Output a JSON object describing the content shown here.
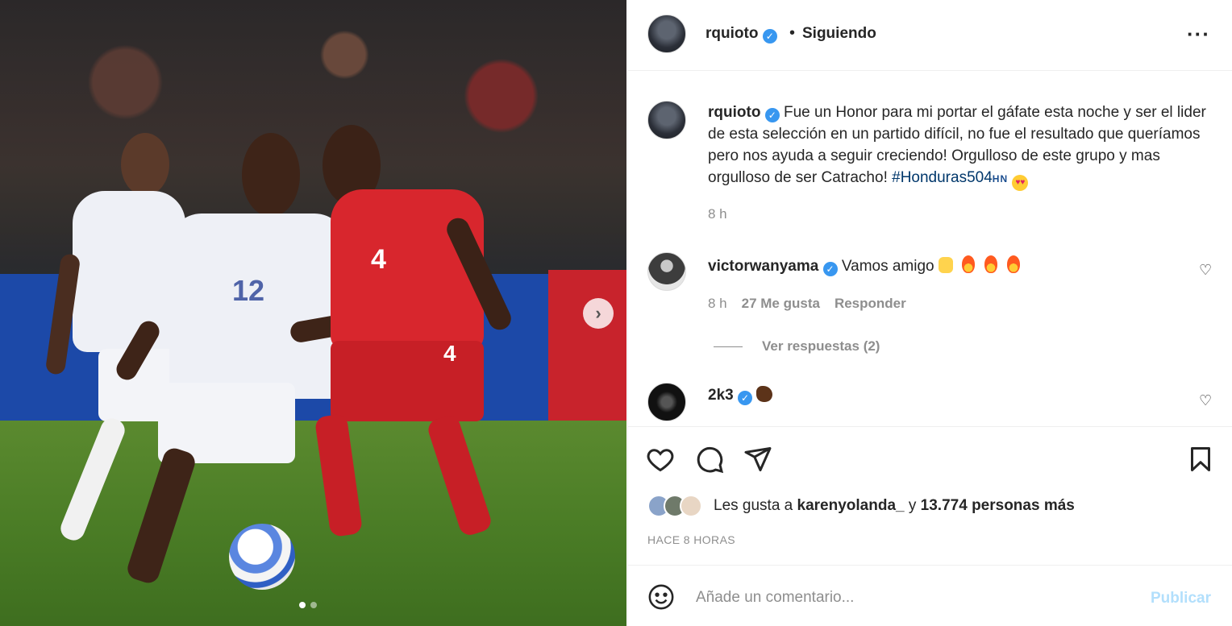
{
  "post": {
    "username": "rquioto",
    "follow_status": "Siguiendo",
    "more_icon": "more-horizontal-icon"
  },
  "media": {
    "description_icons": [
      "next-arrow-icon"
    ],
    "slide_count": 2,
    "active_slide": 1,
    "player_numbers": [
      "12",
      "4",
      "4"
    ]
  },
  "caption": {
    "username": "rquioto",
    "text": "Fue un Honor para mi portar el gáfate esta noche y ser el lider de esta selección en un partido difícil, no fue el resultado que queríamos pero nos ayuda a seguir creciendo! Orgulloso de este grupo y mas orgulloso de ser Catracho! ",
    "hashtag": "#Honduras504",
    "hashtag_suffix": "HN",
    "time": "8 h"
  },
  "comments": [
    {
      "username": "victorwanyama",
      "text": "Vamos amigo",
      "time": "8 h",
      "likes": "27 Me gusta",
      "reply_label": "Responder",
      "view_replies": "Ver respuestas (2)"
    },
    {
      "username": "2k3",
      "text": ""
    }
  ],
  "actions": {
    "icons": [
      "heart-icon",
      "comment-icon",
      "share-icon",
      "bookmark-icon"
    ]
  },
  "likes": {
    "prefix": "Les gusta a ",
    "user": "karenyolanda_",
    "middle": " y ",
    "count": "13.774 personas más"
  },
  "timestamp": "HACE 8 HORAS",
  "add_comment": {
    "placeholder": "Añade un comentario...",
    "publish_label": "Publicar"
  },
  "colors": {
    "accent": "#0095f6",
    "verified": "#3897f0",
    "publish_disabled": "#b2dffc",
    "hashtag": "#00376b"
  }
}
